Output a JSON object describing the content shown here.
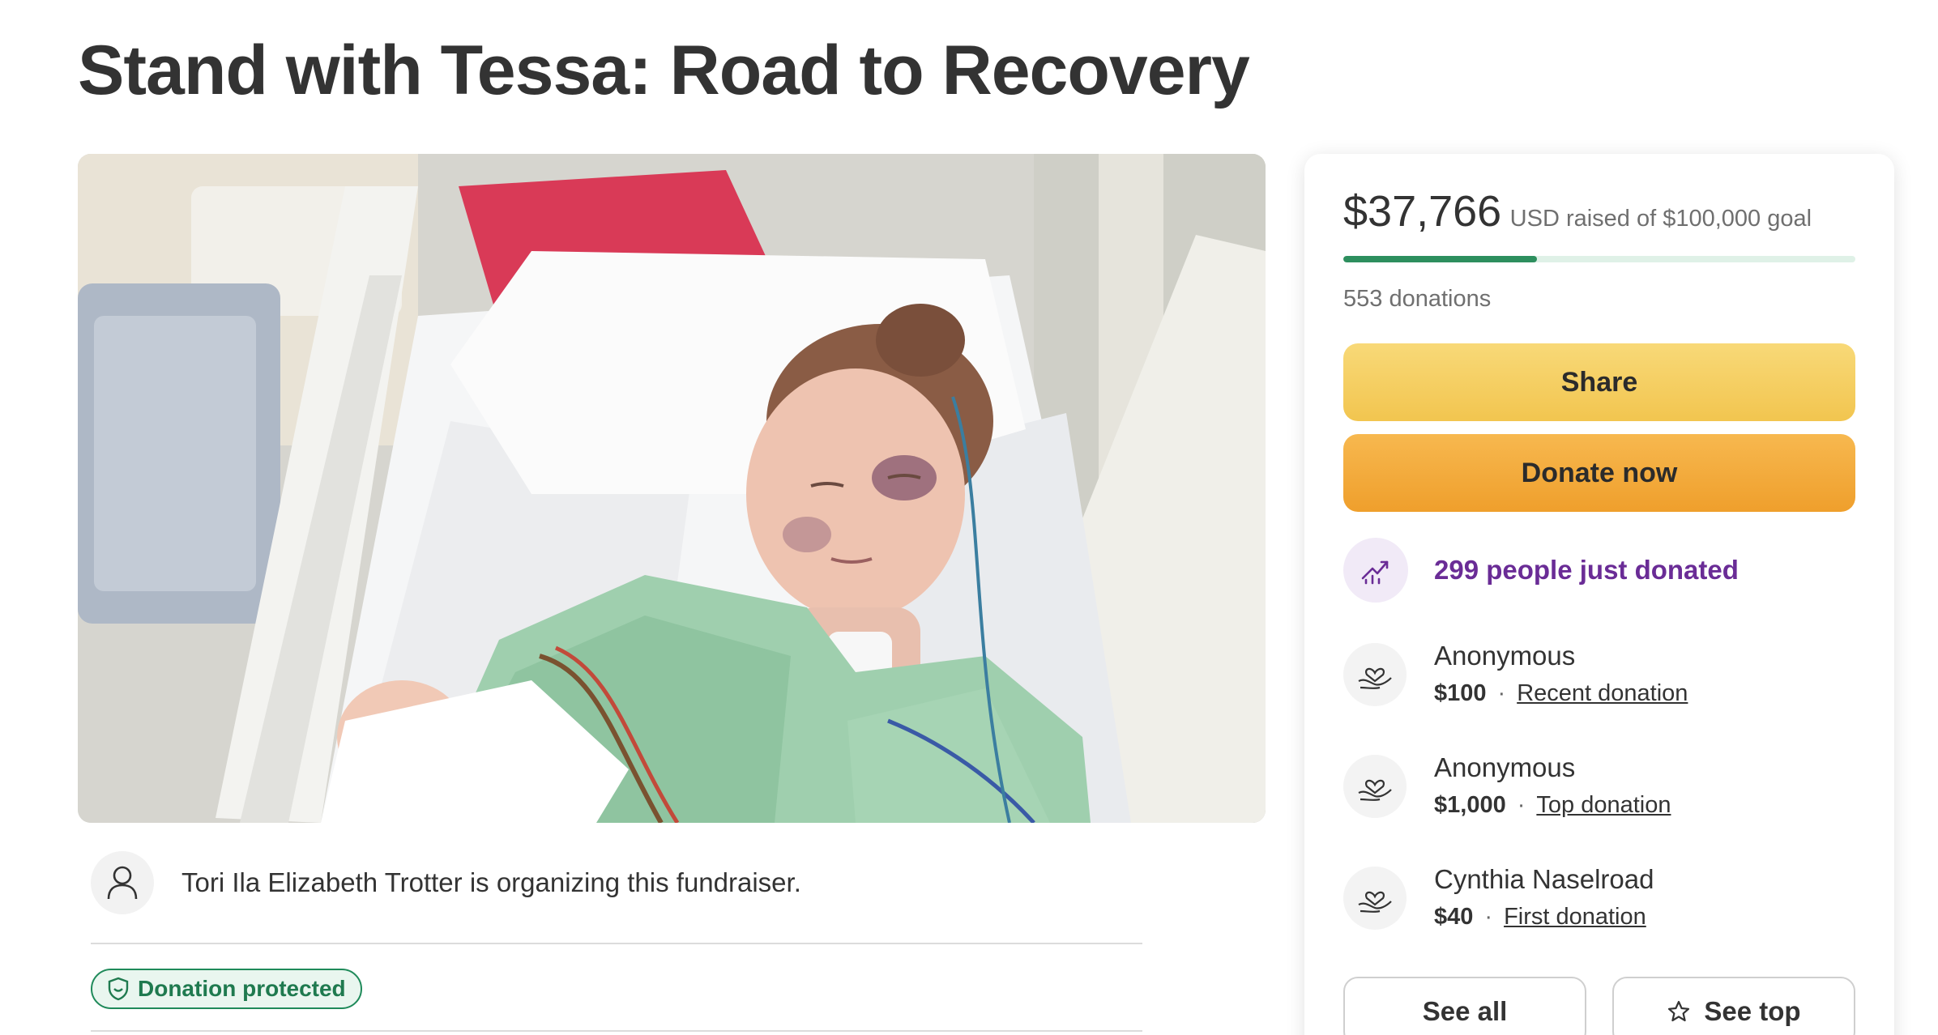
{
  "page": {
    "title": "Stand with Tessa: Road to Recovery"
  },
  "hero_image": {
    "icon": "hospital-patient-photo"
  },
  "organizer": {
    "text": "Tori Ila Elizabeth Trotter is organizing this fundraiser.",
    "icon": "user-icon"
  },
  "badge": {
    "label": "Donation protected",
    "icon": "shield-icon",
    "color": "#1f8a5a"
  },
  "sidebar": {
    "raised_amount": "$37,766",
    "raised_text": "USD raised of $100,000 goal",
    "progress_fraction": 0.37766,
    "donations_count": "553 donations",
    "share_label": "Share",
    "donate_label": "Donate now",
    "trend_text": "299 people just donated",
    "trend_icon": "trending-up-icon",
    "donors": [
      {
        "name": "Anonymous",
        "amount": "$100",
        "dot": "·",
        "type": "Recent donation",
        "icon": "heart-hands-icon"
      },
      {
        "name": "Anonymous",
        "amount": "$1,000",
        "dot": "·",
        "type": "Top donation",
        "icon": "heart-hands-icon"
      },
      {
        "name": "Cynthia Naselroad",
        "amount": "$40",
        "dot": "·",
        "type": "First donation",
        "icon": "heart-hands-icon"
      }
    ],
    "see_all_label": "See all",
    "see_top_label": "See top",
    "see_top_icon": "star-icon"
  },
  "colors": {
    "accent_green": "#2d8f5e",
    "share_yellow": "#f2c54f",
    "donate_orange": "#ef9f2c",
    "trend_purple": "#6a2c96"
  }
}
